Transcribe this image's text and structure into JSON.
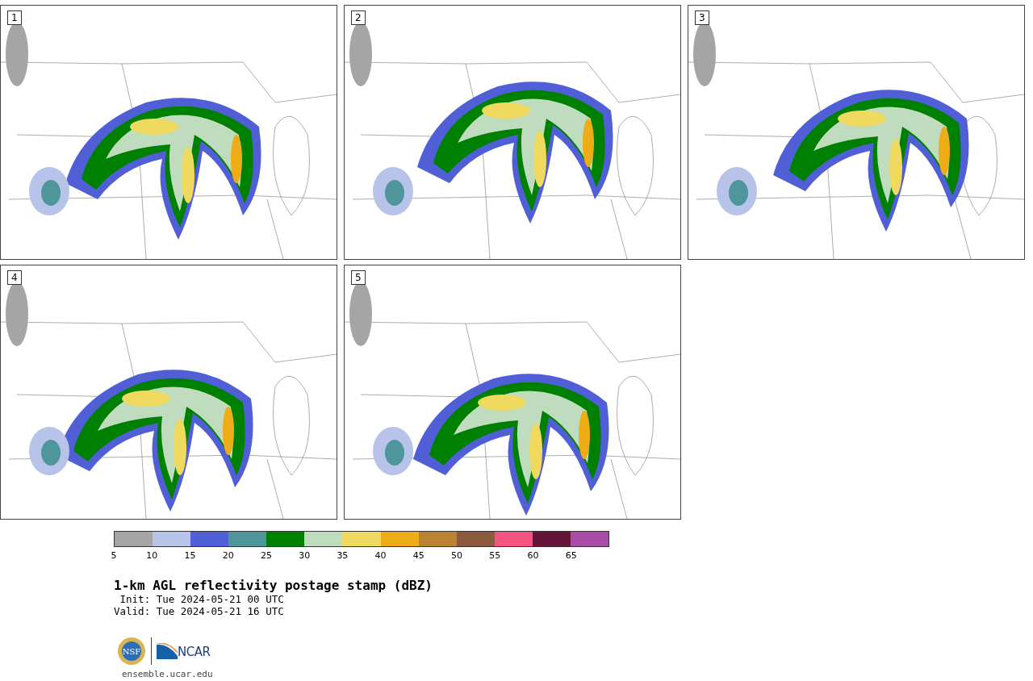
{
  "panels": [
    {
      "label": "1"
    },
    {
      "label": "2"
    },
    {
      "label": "3"
    },
    {
      "label": "4"
    },
    {
      "label": "5"
    }
  ],
  "colorbar": {
    "segments": [
      {
        "color": "#a5a5a5"
      },
      {
        "color": "#b8c3ea"
      },
      {
        "color": "#515fd6"
      },
      {
        "color": "#4f959c"
      },
      {
        "color": "#008000"
      },
      {
        "color": "#bfdcbf"
      },
      {
        "color": "#f0d95f"
      },
      {
        "color": "#eead17"
      },
      {
        "color": "#ba8232"
      },
      {
        "color": "#8b5a3f"
      },
      {
        "color": "#f55381"
      },
      {
        "color": "#641537"
      },
      {
        "color": "#a94ba7"
      }
    ],
    "ticks": [
      "5",
      "10",
      "15",
      "20",
      "25",
      "30",
      "35",
      "40",
      "45",
      "50",
      "55",
      "60",
      "65"
    ]
  },
  "title": "1-km AGL reflectivity postage stamp (dBZ)",
  "init": " Init: Tue 2024-05-21 00 UTC",
  "valid": "Valid: Tue 2024-05-21 16 UTC",
  "logos": {
    "nsf": "NSF",
    "ncar": "NCAR"
  },
  "site": "ensemble.ucar.edu"
}
